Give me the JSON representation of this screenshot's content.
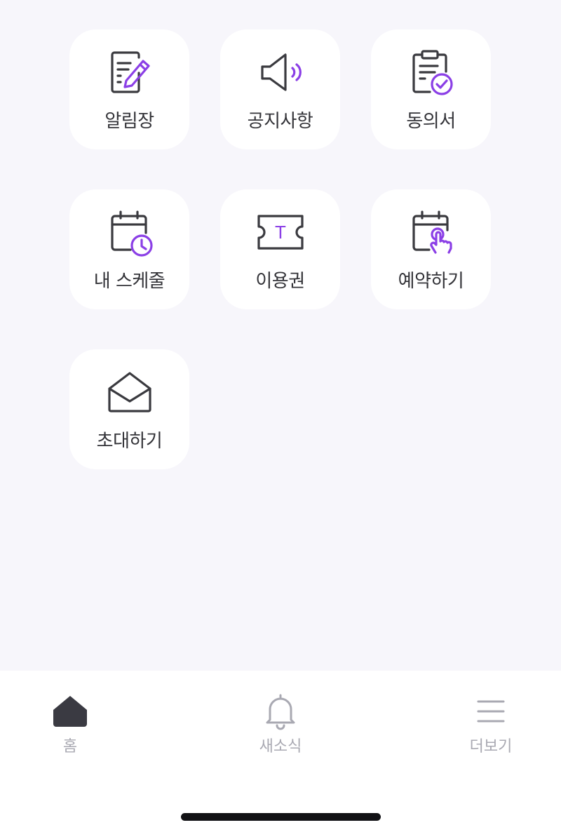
{
  "menu": {
    "items": [
      {
        "label": "알림장",
        "icon": "notebook-pencil-icon"
      },
      {
        "label": "공지사항",
        "icon": "speaker-icon"
      },
      {
        "label": "동의서",
        "icon": "clipboard-check-icon"
      },
      {
        "label": "내 스케줄",
        "icon": "calendar-clock-icon"
      },
      {
        "label": "이용권",
        "icon": "ticket-icon"
      },
      {
        "label": "예약하기",
        "icon": "calendar-touch-icon"
      },
      {
        "label": "초대하기",
        "icon": "envelope-open-icon"
      }
    ],
    "ticket_letter": "T"
  },
  "tabbar": {
    "home": {
      "label": "홈",
      "icon": "home-icon"
    },
    "news": {
      "label": "새소식",
      "icon": "bell-icon"
    },
    "more": {
      "label": "더보기",
      "icon": "menu-icon"
    }
  },
  "colors": {
    "background": "#f7f6fb",
    "tile": "#ffffff",
    "icon_stroke": "#3a3a3f",
    "accent_purple": "#8b3fe6",
    "tab_inactive": "#a9a9b2",
    "tab_active_icon": "#3a3a42"
  }
}
